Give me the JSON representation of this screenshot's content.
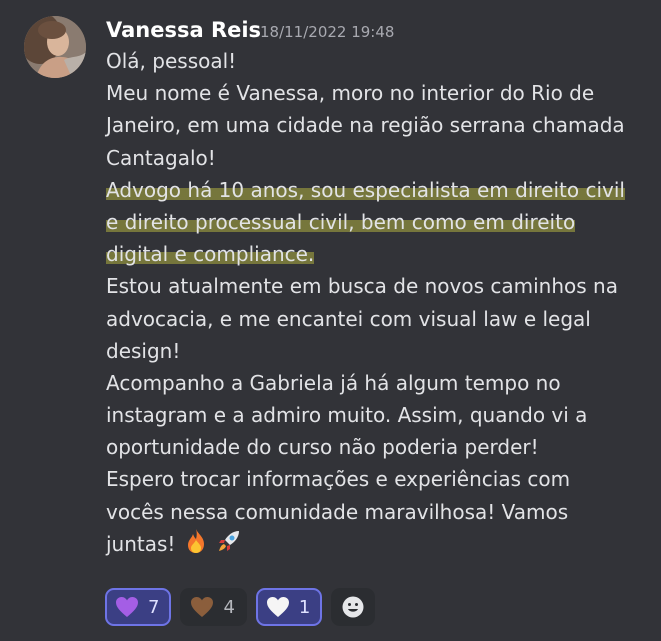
{
  "message": {
    "author": "Vanessa Reis",
    "timestamp": "18/11/2022 19:48",
    "lines": [
      {
        "text": "Olá, pessoal!",
        "highlight": false
      },
      {
        "text": "Meu nome é Vanessa, moro no interior do Rio de",
        "highlight": false
      },
      {
        "text": "Janeiro, em uma cidade na região serrana chamada",
        "highlight": false
      },
      {
        "text": "Cantagalo!",
        "highlight": false
      },
      {
        "text": "Advogo há 10 anos, sou especialista em direito civil",
        "highlight": true
      },
      {
        "text": "e direito processual civil, bem como em direito",
        "highlight": true
      },
      {
        "text": "digital e compliance.",
        "highlight": true
      },
      {
        "text": "Estou atualmente em busca de novos caminhos na",
        "highlight": false
      },
      {
        "text": "advocacia, e me encantei com visual law e legal",
        "highlight": false
      },
      {
        "text": "design!",
        "highlight": false
      },
      {
        "text": "Acompanho a Gabriela já há algum tempo no",
        "highlight": false
      },
      {
        "text": "instagram e a admiro muito. Assim, quando vi a",
        "highlight": false
      },
      {
        "text": "oportunidade do curso não poderia perder!",
        "highlight": false
      },
      {
        "text": "Espero trocar informações e experiências com",
        "highlight": false
      },
      {
        "text": "vocês nessa comunidade maravilhosa! Vamos",
        "highlight": false
      },
      {
        "text": "juntas!",
        "highlight": false
      }
    ],
    "trailing_emojis": [
      "fire-emoji",
      "rocket-emoji"
    ],
    "highlight_color": "#d4d442"
  },
  "reactions": [
    {
      "icon": "purple-heart-icon",
      "color": "#a45ee5",
      "count": "7",
      "reacted": true
    },
    {
      "icon": "brown-heart-icon",
      "color": "#8b5e3c",
      "count": "4",
      "reacted": false
    },
    {
      "icon": "white-heart-icon",
      "color": "#f5f5f5",
      "count": "1",
      "reacted": true
    }
  ],
  "add_reaction": {
    "icon": "add-reaction-smiley-icon"
  },
  "colors": {
    "background": "#323338",
    "author": "#ffffff",
    "timestamp": "#a8a9b0",
    "text": "#e2e3e6",
    "reaction_active_bg": "#3b3f84",
    "reaction_active_border": "#6e74e6",
    "reaction_bg": "#2b2d31"
  }
}
